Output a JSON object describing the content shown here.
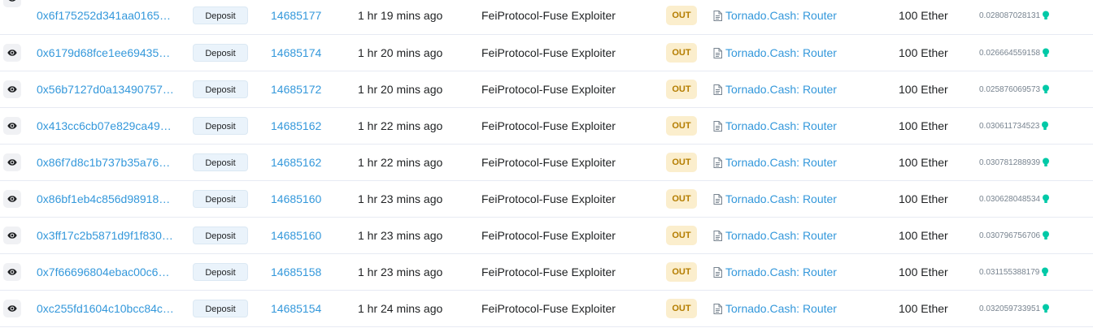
{
  "rows": [
    {
      "hash": "0x6f175252d341aa0165…",
      "method": "Deposit",
      "block": "14685177",
      "age": "1 hr 19 mins ago",
      "from": "FeiProtocol-Fuse Exploiter",
      "direction": "OUT",
      "to": "Tornado.Cash: Router",
      "value": "100 Ether",
      "fee": "0.028087028131"
    },
    {
      "hash": "0x6179d68fce1ee69435…",
      "method": "Deposit",
      "block": "14685174",
      "age": "1 hr 20 mins ago",
      "from": "FeiProtocol-Fuse Exploiter",
      "direction": "OUT",
      "to": "Tornado.Cash: Router",
      "value": "100 Ether",
      "fee": "0.026664559158"
    },
    {
      "hash": "0x56b7127d0a13490757…",
      "method": "Deposit",
      "block": "14685172",
      "age": "1 hr 20 mins ago",
      "from": "FeiProtocol-Fuse Exploiter",
      "direction": "OUT",
      "to": "Tornado.Cash: Router",
      "value": "100 Ether",
      "fee": "0.025876069573"
    },
    {
      "hash": "0x413cc6cb07e829ca49…",
      "method": "Deposit",
      "block": "14685162",
      "age": "1 hr 22 mins ago",
      "from": "FeiProtocol-Fuse Exploiter",
      "direction": "OUT",
      "to": "Tornado.Cash: Router",
      "value": "100 Ether",
      "fee": "0.030611734523"
    },
    {
      "hash": "0x86f7d8c1b737b35a76…",
      "method": "Deposit",
      "block": "14685162",
      "age": "1 hr 22 mins ago",
      "from": "FeiProtocol-Fuse Exploiter",
      "direction": "OUT",
      "to": "Tornado.Cash: Router",
      "value": "100 Ether",
      "fee": "0.030781288939"
    },
    {
      "hash": "0x86bf1eb4c856d98918…",
      "method": "Deposit",
      "block": "14685160",
      "age": "1 hr 23 mins ago",
      "from": "FeiProtocol-Fuse Exploiter",
      "direction": "OUT",
      "to": "Tornado.Cash: Router",
      "value": "100 Ether",
      "fee": "0.030628048534"
    },
    {
      "hash": "0x3ff17c2b5871d9f1f830…",
      "method": "Deposit",
      "block": "14685160",
      "age": "1 hr 23 mins ago",
      "from": "FeiProtocol-Fuse Exploiter",
      "direction": "OUT",
      "to": "Tornado.Cash: Router",
      "value": "100 Ether",
      "fee": "0.030796756706"
    },
    {
      "hash": "0x7f66696804ebac00c6…",
      "method": "Deposit",
      "block": "14685158",
      "age": "1 hr 23 mins ago",
      "from": "FeiProtocol-Fuse Exploiter",
      "direction": "OUT",
      "to": "Tornado.Cash: Router",
      "value": "100 Ether",
      "fee": "0.031155388179"
    },
    {
      "hash": "0xc255fd1604c10bcc84c…",
      "method": "Deposit",
      "block": "14685154",
      "age": "1 hr 24 mins ago",
      "from": "FeiProtocol-Fuse Exploiter",
      "direction": "OUT",
      "to": "Tornado.Cash: Router",
      "value": "100 Ether",
      "fee": "0.032059733951"
    }
  ],
  "icons": {
    "preview": "eye-icon",
    "contract": "file-document-icon",
    "fee_status": "lightbulb-icon"
  },
  "colors": {
    "link": "#3498db",
    "out_badge_bg": "#fbeecd",
    "out_badge_text": "#b47d00",
    "fee_icon": "#00c9a7"
  }
}
